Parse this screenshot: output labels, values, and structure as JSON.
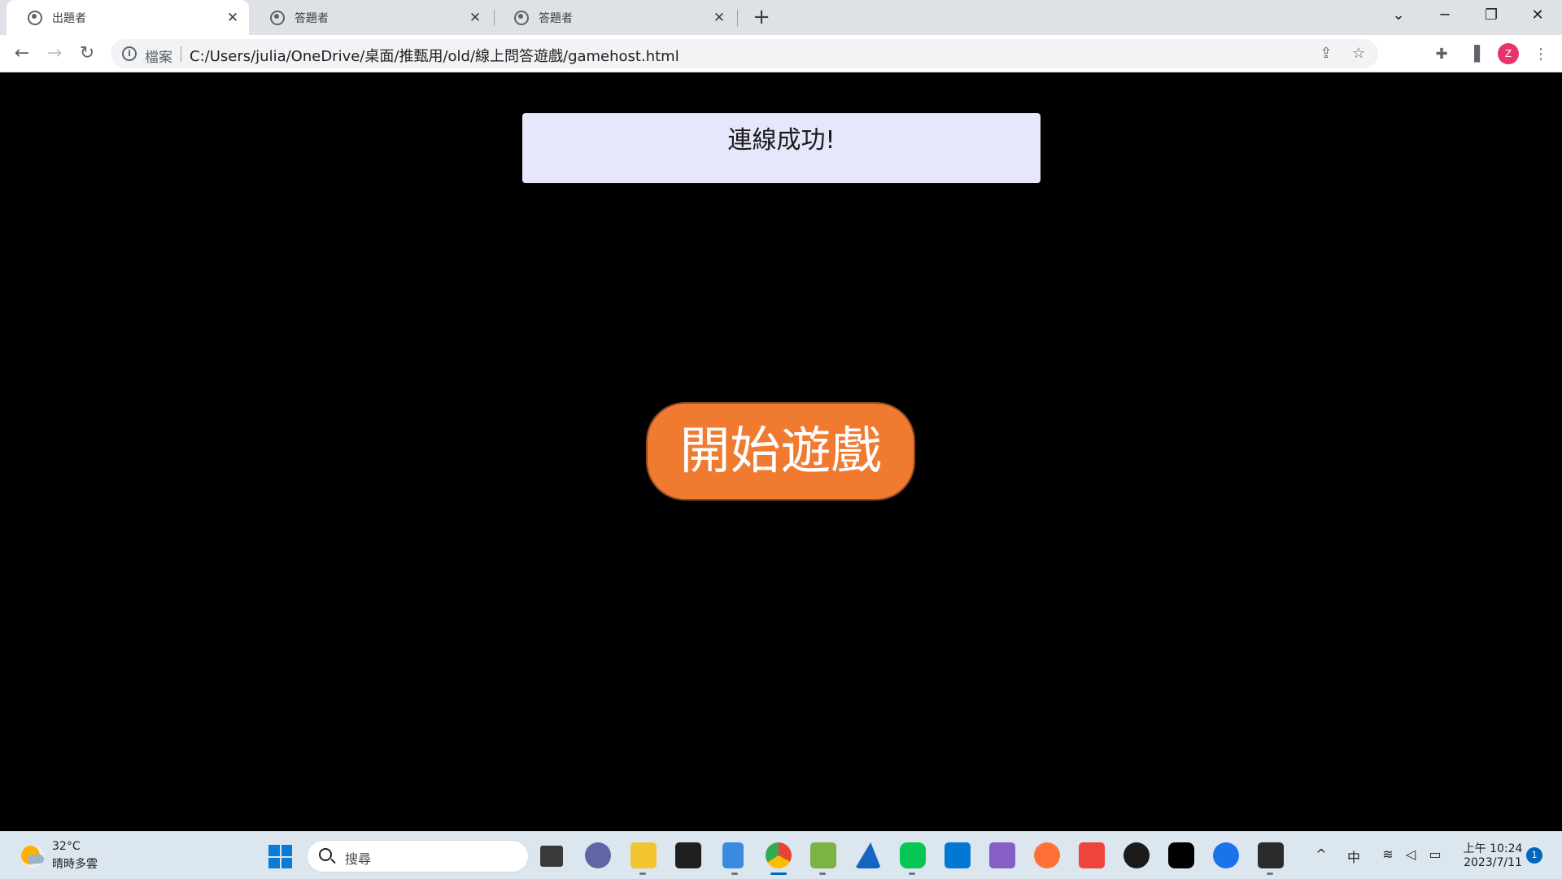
{
  "browser": {
    "tabs": [
      {
        "title": "出題者",
        "active": true
      },
      {
        "title": "答題者",
        "active": false
      },
      {
        "title": "答題者",
        "active": false
      }
    ],
    "new_tab_label": "+",
    "address_scheme_label": "檔案",
    "url": "C:/Users/julia/OneDrive/桌面/推甄用/old/線上問答遊戲/gamehost.html",
    "profile_initial": "Z",
    "profile_color": "#e8336b"
  },
  "page": {
    "status_text": "連線成功!",
    "start_button_label": "開始遊戲",
    "colors": {
      "background": "#000000",
      "status_box": "#e6e7fa",
      "start_button": "#f07a30"
    }
  },
  "taskbar": {
    "weather": {
      "temperature": "32°C",
      "condition": "晴時多雲"
    },
    "search_placeholder": "搜尋",
    "pinned_apps": [
      "task-view",
      "teams-chat",
      "file-explorer",
      "terminal",
      "notepad",
      "chrome",
      "photos",
      "wireshark",
      "line",
      "vscode",
      "visual-studio",
      "firefox",
      "anydesk",
      "obs",
      "capcut",
      "maps",
      "cmd"
    ],
    "input_method": "中",
    "clock": {
      "time": "上午 10:24",
      "date": "2023/7/11"
    },
    "notification_count": "1"
  }
}
